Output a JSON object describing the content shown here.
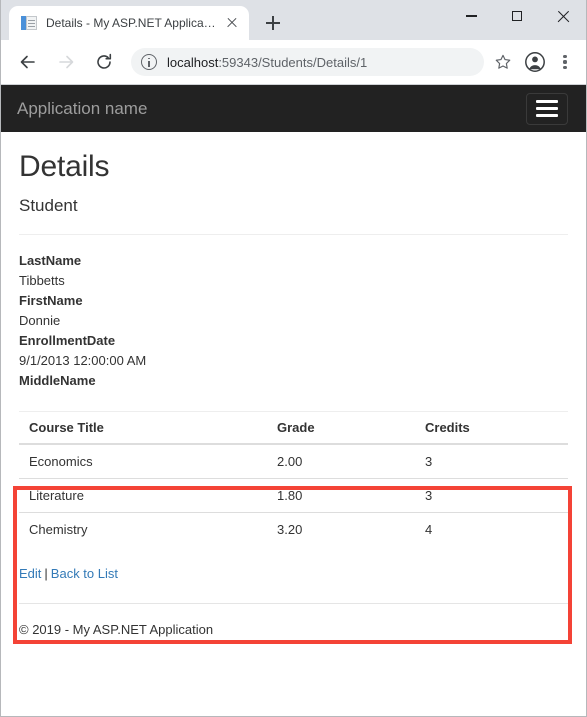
{
  "browser": {
    "tab": {
      "title": "Details - My ASP.NET Application",
      "favicon": "document-icon",
      "close_icon": "close-icon"
    },
    "new_tab_icon": "plus-icon",
    "window_controls": {
      "minimize": "minimize-icon",
      "maximize": "maximize-icon",
      "close": "close-icon"
    },
    "toolbar": {
      "back_icon": "back-arrow-icon",
      "forward_icon": "forward-arrow-icon",
      "reload_icon": "reload-icon",
      "site_info_icon": "info-circle-icon",
      "url_host": "localhost",
      "url_path": ":59343/Students/Details/1",
      "bookmark_icon": "star-icon",
      "profile_icon": "account-avatar-icon",
      "menu_icon": "kebab-menu-icon"
    }
  },
  "page": {
    "navbar": {
      "brand": "Application name",
      "toggle_icon": "hamburger-menu-icon"
    },
    "title": "Details",
    "subtitle": "Student",
    "details": [
      {
        "label": "LastName",
        "value": "Tibbetts"
      },
      {
        "label": "FirstName",
        "value": "Donnie"
      },
      {
        "label": "EnrollmentDate",
        "value": "9/1/2013 12:00:00 AM"
      },
      {
        "label": "MiddleName",
        "value": ""
      }
    ],
    "courses_table": {
      "headers": [
        "Course Title",
        "Grade",
        "Credits"
      ],
      "rows": [
        {
          "course": "Economics",
          "grade": "2.00",
          "credits": "3"
        },
        {
          "course": "Literature",
          "grade": "1.80",
          "credits": "3"
        },
        {
          "course": "Chemistry",
          "grade": "3.20",
          "credits": "4"
        }
      ]
    },
    "actions": {
      "edit": "Edit",
      "separator": "|",
      "back": "Back to List"
    },
    "footer": "© 2019 - My ASP.NET Application"
  },
  "annotation": {
    "color": "#f44336",
    "target": "courses-table"
  }
}
